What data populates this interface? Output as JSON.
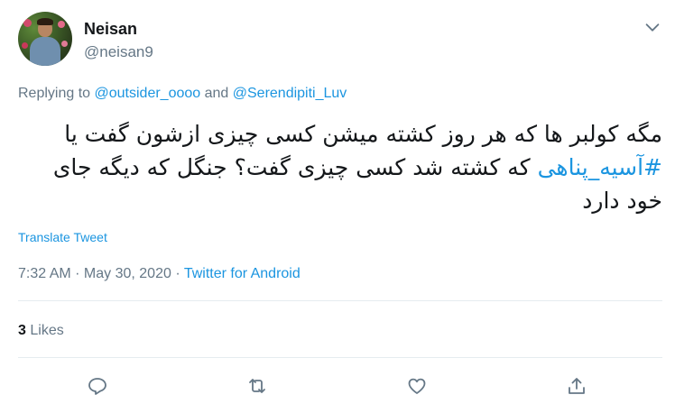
{
  "author": {
    "display_name": "Neisan",
    "handle": "@neisan9"
  },
  "replying": {
    "prefix": "Replying to ",
    "users": [
      "@outsider_oooo",
      "@Serendipiti_Luv"
    ],
    "joiner": " and "
  },
  "tweet": {
    "text_before": "مگه کولبر ها که هر روز کشته میشن کسی چیزی ازشون گفت یا ",
    "hashtag": "#آسیه_پناهی",
    "text_after": " که کشته شد کسی چیزی گفت؟ جنگل که دیگه جای خود دارد",
    "translate_label": "Translate Tweet"
  },
  "meta": {
    "time": "7:32 AM",
    "separator1": " · ",
    "date": "May 30, 2020",
    "separator2": " · ",
    "source": "Twitter for Android"
  },
  "stats": {
    "likes_count": "3",
    "likes_label": "Likes"
  },
  "actions": {
    "reply_icon": "reply-icon",
    "retweet_icon": "retweet-icon",
    "like_icon": "heart-icon",
    "share_icon": "share-icon"
  },
  "colors": {
    "link": "#1b95e0",
    "secondary_text": "#657786",
    "primary_text": "#14171a",
    "divider": "#e6ecf0"
  }
}
